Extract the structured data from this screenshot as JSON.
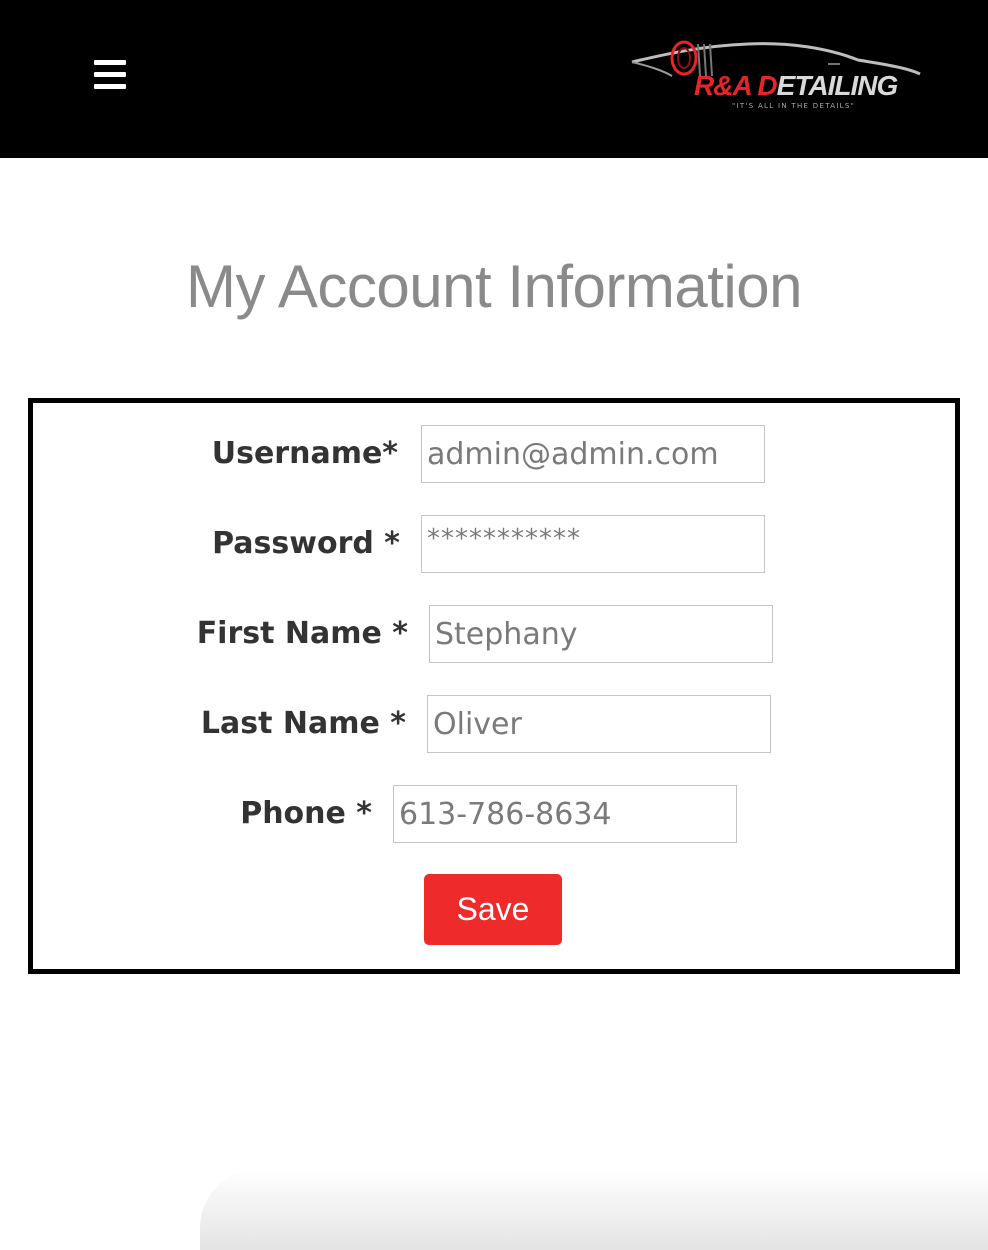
{
  "header": {
    "menu_icon": "hamburger-menu-icon",
    "logo": {
      "brand_part1": "R&A ",
      "brand_part2": "D",
      "brand_part3": "ETAILING",
      "tagline": "\"IT'S ALL IN THE DETAILS\""
    },
    "background_color": "#000000"
  },
  "main": {
    "title": "My Account Information"
  },
  "form": {
    "fields": [
      {
        "label": "Username*",
        "value": "admin@admin.com",
        "type": "text"
      },
      {
        "label": "Password *",
        "value": "***********",
        "type": "text"
      },
      {
        "label": "First Name *",
        "value": "Stephany",
        "type": "text"
      },
      {
        "label": "Last Name *",
        "value": "Oliver",
        "type": "text"
      },
      {
        "label": "Phone *",
        "value": "613-786-8634",
        "type": "text"
      }
    ],
    "save_label": "Save",
    "save_color": "#ee2a2a"
  }
}
